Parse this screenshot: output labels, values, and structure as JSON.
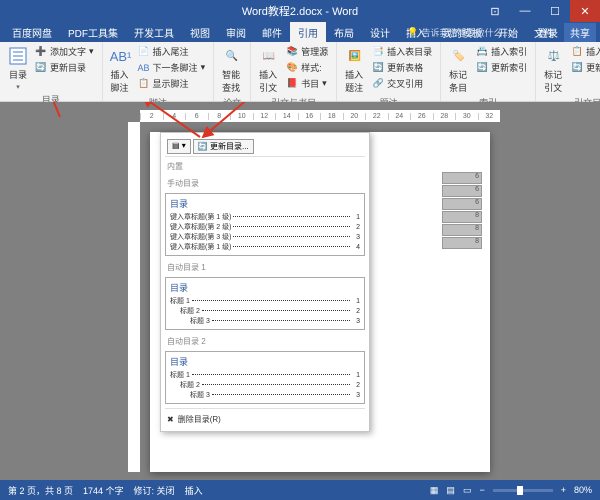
{
  "title": "Word教程2.docx - Word",
  "window": {
    "login": "登录",
    "share": "共享"
  },
  "tell_me": "告诉我您想要做什么...",
  "menu": [
    "文件",
    "开始",
    "我的模板",
    "插入",
    "设计",
    "布局",
    "引用",
    "邮件",
    "审阅",
    "视图",
    "开发工具",
    "PDF工具集",
    "百度网盘"
  ],
  "active_menu": 6,
  "ribbon": {
    "toc": {
      "group": "目录",
      "main": "目录",
      "add_text": "添加文字",
      "update": "更新目录"
    },
    "footnote": {
      "group": "脚注",
      "main": "插入脚注",
      "insert_end": "插入尾注",
      "next": "下一条脚注",
      "show": "显示脚注"
    },
    "research": {
      "group": "论文",
      "main": "智能查找"
    },
    "citation": {
      "group": "引文与书目",
      "main": "插入引文",
      "manage": "管理源",
      "style": "样式:",
      "biblio": "书目"
    },
    "caption": {
      "group": "题注",
      "main": "插入题注",
      "fig_toc": "插入表目录",
      "update_tbl": "更新表格",
      "cross": "交叉引用"
    },
    "index": {
      "group": "索引",
      "main": "标记条目",
      "insert": "插入索引",
      "update": "更新索引"
    },
    "toa": {
      "group": "引文目录",
      "main": "标记引文",
      "insert": "插入引文目录",
      "update": "更新引文目录"
    }
  },
  "ruler": [
    "2",
    "4",
    "6",
    "8",
    "10",
    "12",
    "14",
    "16",
    "18",
    "20",
    "22",
    "24",
    "26",
    "28",
    "30",
    "32"
  ],
  "dropdown": {
    "header_btn": "更新目录...",
    "builtin": "内置",
    "manual_label": "手动目录",
    "auto1_label": "自动目录 1",
    "auto2_label": "自动目录 2",
    "toc_title": "目录",
    "manual": [
      {
        "t": "键入章标题(第 1 级)",
        "p": "1"
      },
      {
        "t": "键入章标题(第 2 级)",
        "p": "2"
      },
      {
        "t": "键入章标题(第 3 级)",
        "p": "3"
      },
      {
        "t": "键入章标题(第 1 级)",
        "p": "4"
      }
    ],
    "auto": [
      {
        "t": "标题 1",
        "p": "1"
      },
      {
        "t": "标题 2",
        "p": "2"
      },
      {
        "t": "标题 3",
        "p": "3"
      }
    ],
    "remove": "删除目录(R)"
  },
  "side_pages": [
    "6",
    "6",
    "6",
    "8",
    "8",
    "8"
  ],
  "status": {
    "page": "第 2 页，共 8 页",
    "words": "1744 个字",
    "lang": "修订: 关闭",
    "ime": "插入",
    "zoom": "80%"
  }
}
